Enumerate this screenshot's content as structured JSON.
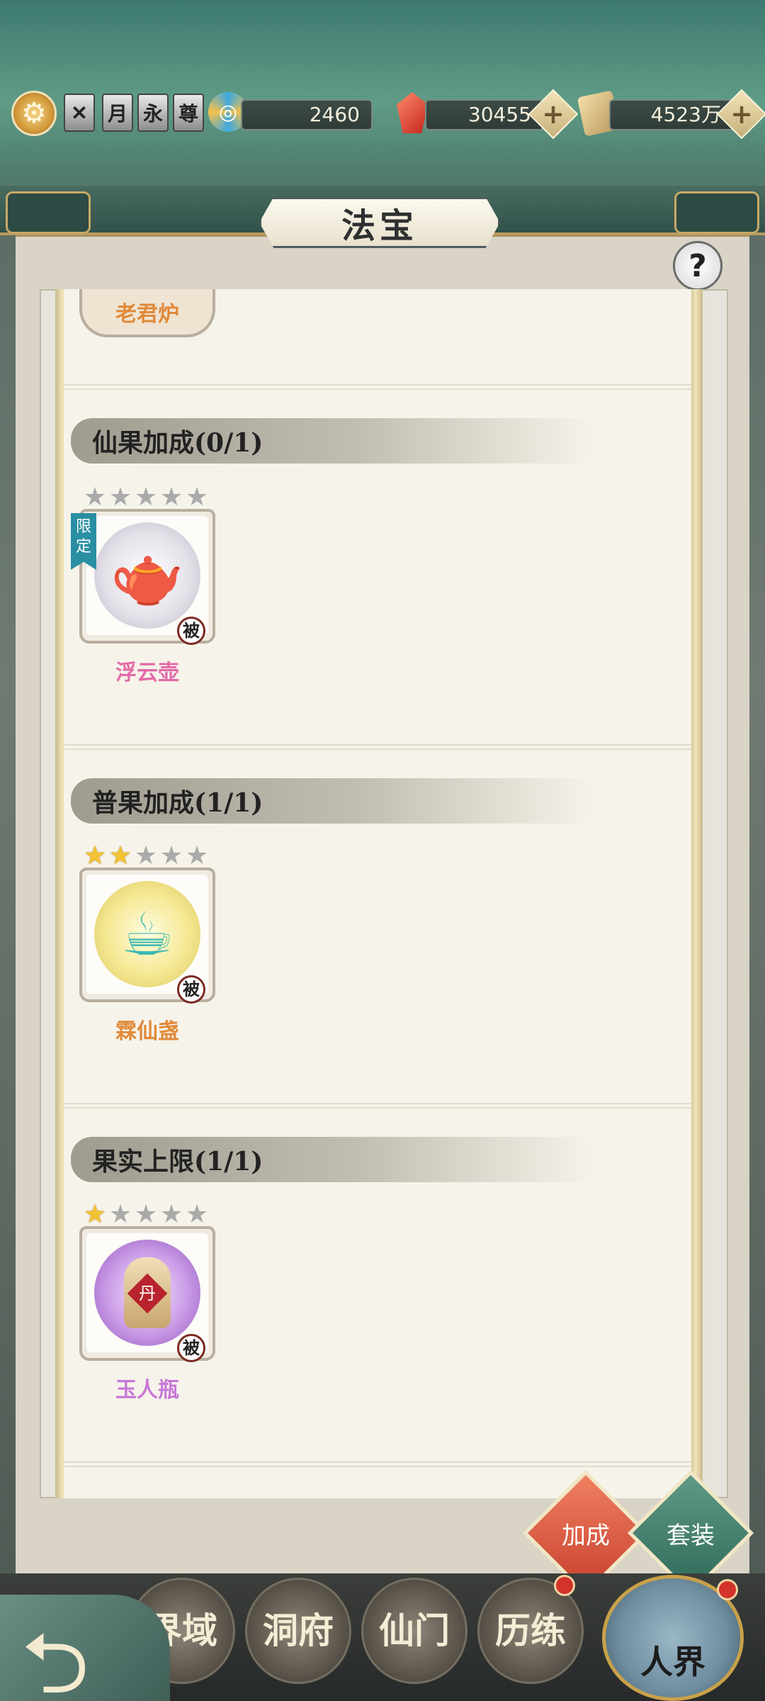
{
  "topbar": {
    "icons": [
      "gear-icon",
      "fire-badge-icon",
      "moon-badge-icon",
      "eternal-badge-icon",
      "honor-badge-icon",
      "spirit-swirl-icon"
    ],
    "badges": [
      "月",
      "永",
      "尊"
    ],
    "spirit_value": "2460",
    "gem_value": "30455",
    "scroll_value": "4523万"
  },
  "header": {
    "title": "法宝"
  },
  "sections": [
    {
      "title": "",
      "cards": [
        {
          "name": "老君炉",
          "name_color": "#e08a3a"
        }
      ]
    },
    {
      "title": "仙果加成(0/1)",
      "cards": [
        {
          "name": "浮云壶",
          "name_color": "#e36aa8",
          "tag": "限定",
          "stars": 0,
          "max_stars": 5,
          "passive": "被",
          "icon": "silver-teapot-icon"
        }
      ]
    },
    {
      "title": "普果加成(1/1)",
      "cards": [
        {
          "name": "霖仙盏",
          "name_color": "#e08a3a",
          "stars": 2,
          "max_stars": 5,
          "passive": "被",
          "icon": "jade-cup-icon"
        }
      ]
    },
    {
      "title": "果实上限(1/1)",
      "cards": [
        {
          "name": "玉人瓶",
          "name_color": "#c878d8",
          "stars": 1,
          "max_stars": 5,
          "passive": "被",
          "icon": "elixir-bottle-icon",
          "bottle_text": "丹"
        }
      ]
    }
  ],
  "actions": {
    "bonus": "加成",
    "set": "套装"
  },
  "bottom_nav": {
    "items": [
      "界域",
      "洞府",
      "仙门",
      "历练"
    ],
    "realm": "人界"
  }
}
